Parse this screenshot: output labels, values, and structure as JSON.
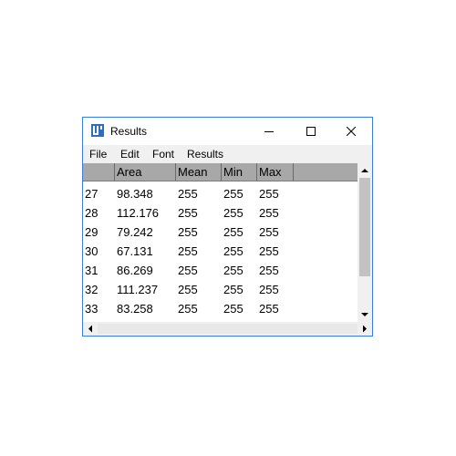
{
  "window": {
    "title": "Results",
    "icon": "imagej-icon",
    "controls": [
      "minimize-icon",
      "maximize-icon",
      "close-icon"
    ],
    "border_color": "#3b7fd4"
  },
  "menu": {
    "items": [
      "File",
      "Edit",
      "Font",
      "Results"
    ]
  },
  "table": {
    "columns": [
      "",
      "Area",
      "Mean",
      "Min",
      "Max"
    ],
    "rows": [
      [
        "27",
        "98.348",
        "255",
        "255",
        "255"
      ],
      [
        "28",
        "112.176",
        "255",
        "255",
        "255"
      ],
      [
        "29",
        "79.242",
        "255",
        "255",
        "255"
      ],
      [
        "30",
        "67.131",
        "255",
        "255",
        "255"
      ],
      [
        "31",
        "86.269",
        "255",
        "255",
        "255"
      ],
      [
        "32",
        "111.237",
        "255",
        "255",
        "255"
      ],
      [
        "33",
        "83.258",
        "255",
        "255",
        "255"
      ]
    ],
    "header_bg": "#a8a8a8"
  },
  "scrollbars": {
    "vertical": {
      "up": "up-arrow-icon",
      "down": "down-arrow-icon"
    },
    "horizontal": {
      "left": "left-arrow-icon",
      "right": "right-arrow-icon"
    }
  }
}
